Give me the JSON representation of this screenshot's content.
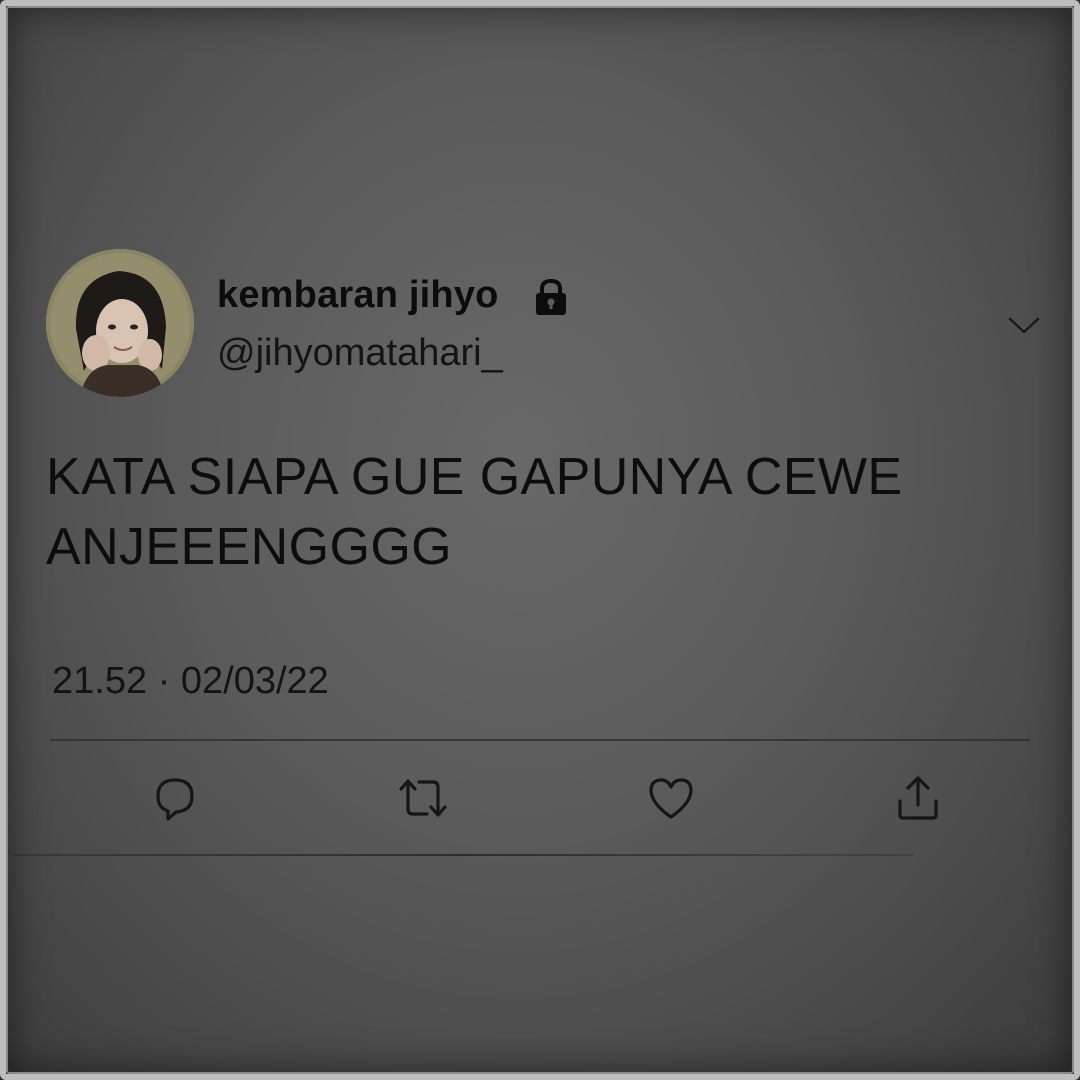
{
  "tweet": {
    "display_name": "kembaran jihyo",
    "handle": "@jihyomatahari_",
    "protected_icon": "lock-icon",
    "text": "KATA SIAPA GUE GAPUNYA CEWE ANJEEENGGGG",
    "timestamp": "21.52 · 02/03/22",
    "menu_icon": "chevron-down-icon",
    "actions": [
      {
        "name": "reply",
        "icon": "reply-icon"
      },
      {
        "name": "retweet",
        "icon": "retweet-icon"
      },
      {
        "name": "like",
        "icon": "heart-icon"
      },
      {
        "name": "share",
        "icon": "share-icon"
      }
    ]
  },
  "colors": {
    "background": "#5c5c5c",
    "text": "#0d0d0d",
    "frame_border": "#bdbdbd"
  }
}
